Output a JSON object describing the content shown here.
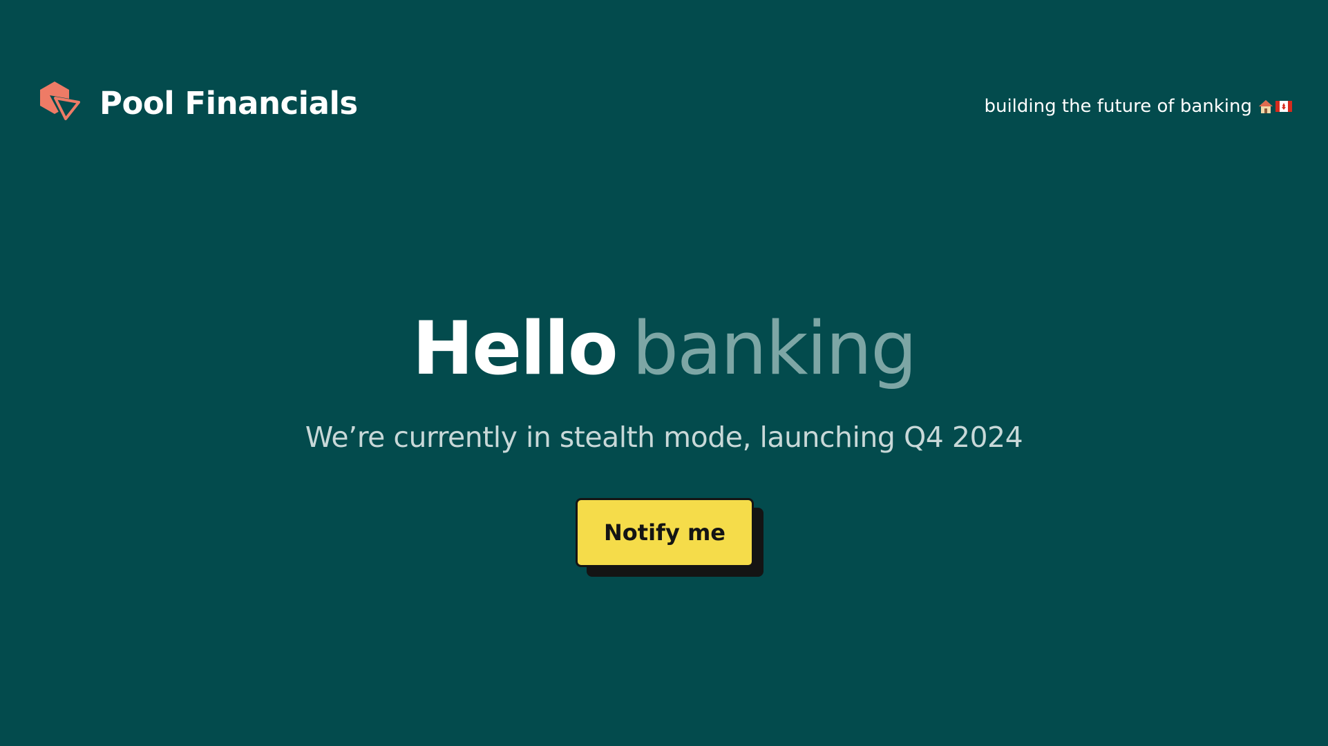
{
  "brand": {
    "name": "Pool Financials",
    "logo_icon": "hexagon-triangle-logo-icon"
  },
  "tagline": {
    "text": "building the future of banking",
    "emoji_icons": [
      "house-icon",
      "canada-flag-icon"
    ]
  },
  "hero": {
    "title_word_1": "Hello",
    "title_word_2": "banking",
    "subtitle": "We’re currently in stealth mode, launching Q4 2024"
  },
  "cta": {
    "label": "Notify me"
  },
  "colors": {
    "background": "#034b4d",
    "logo": "#ee7b66",
    "title_primary": "#ffffff",
    "title_accent": "#7da6a5",
    "subtitle": "#c8d8d8",
    "button": "#f5dc4a",
    "button_shadow": "#141414"
  }
}
